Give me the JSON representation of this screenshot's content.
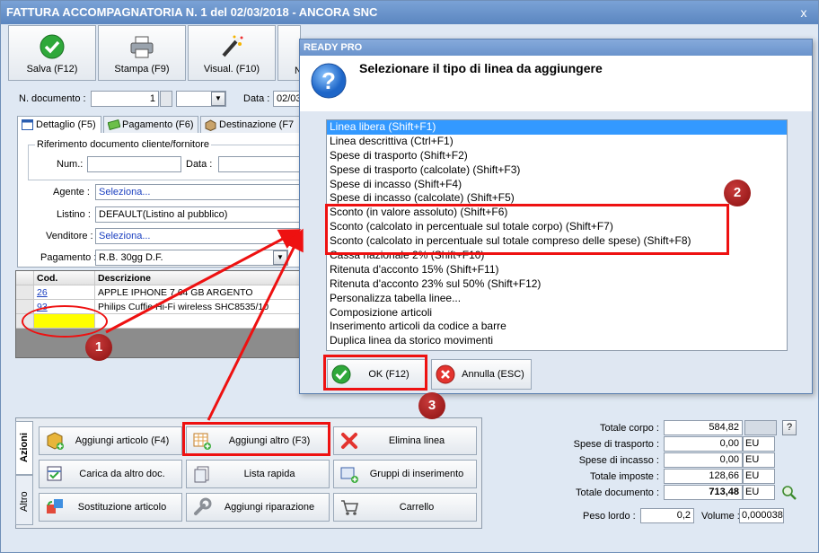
{
  "window": {
    "title": "FATTURA ACCOMPAGNATORIA N. 1 del 02/03/2018 - ANCORA SNC",
    "close": "x"
  },
  "toolbar": {
    "save": "Salva (F12)",
    "print": "Stampa (F9)",
    "visual": "Visual. (F10)",
    "hidden": "N"
  },
  "header": {
    "doc_label": "N. documento :",
    "doc_value": "1",
    "date_label": "Data :",
    "date_value": "02/03"
  },
  "tabs": [
    "Dettaglio (F5)",
    "Pagamento (F6)",
    "Destinazione (F7"
  ],
  "reference": {
    "title": "Riferimento documento cliente/fornitore",
    "num_label": "Num.:",
    "date_label": "Data :"
  },
  "fields": {
    "agente_label": "Agente :",
    "agente_value": "Seleziona...",
    "listino_label": "Listino :",
    "listino_value": "DEFAULT(Listino al pubblico)",
    "venditore_label": "Venditore :",
    "venditore_value": "Seleziona...",
    "pagamento_label": "Pagamento :",
    "pagamento_value": "R.B. 30gg D.F."
  },
  "grid": {
    "col_cod": "Cod.",
    "col_desc": "Descrizione",
    "rows": [
      {
        "cod": "26",
        "desc": "APPLE IPHONE 7 64 GB ARGENTO"
      },
      {
        "cod": "93",
        "desc": "Philips Cuffie Hi-Fi wireless SHC8535/10"
      }
    ]
  },
  "actions": {
    "tab_azioni": "Azioni",
    "tab_altro": "Altro",
    "add_article": "Aggiungi articolo (F4)",
    "add_other": "Aggiungi altro (F3)",
    "delete_line": "Elimina linea",
    "load_other": "Carica da altro doc.",
    "quick_list": "Lista rapida",
    "insert_groups": "Gruppi di inserimento",
    "replace_article": "Sostituzione articolo",
    "add_repair": "Aggiungi riparazione",
    "cart": "Carrello"
  },
  "totals": {
    "corpo_label": "Totale corpo :",
    "corpo_value": "584,82",
    "trasporto_label": "Spese di trasporto :",
    "trasporto_value": "0,00",
    "incasso_label": "Spese di incasso :",
    "incasso_value": "0,00",
    "imposte_label": "Totale imposte :",
    "imposte_value": "128,66",
    "documento_label": "Totale documento :",
    "documento_value": "713,48",
    "currency": "EU",
    "help": "?",
    "peso_label": "Peso lordo :",
    "peso_value": "0,2",
    "volume_label": "Volume :",
    "volume_value": "0,000038"
  },
  "dialog": {
    "title": "READY PRO",
    "heading": "Selezionare il tipo di linea da aggiungere",
    "items": [
      "Linea libera (Shift+F1)",
      "Linea descrittiva (Ctrl+F1)",
      "Spese di trasporto (Shift+F2)",
      "Spese di trasporto (calcolate) (Shift+F3)",
      "Spese di incasso (Shift+F4)",
      "Spese di incasso (calcolate) (Shift+F5)",
      "Sconto (in valore assoluto) (Shift+F6)",
      "Sconto (calcolato in percentuale sul totale corpo) (Shift+F7)",
      "Sconto (calcolato in percentuale sul totale compreso delle spese) (Shift+F8)",
      "Cassa nazionale 2% (Shift+F10)",
      "Ritenuta d'acconto 15% (Shift+F11)",
      "Ritenuta d'acconto 23% sul 50% (Shift+F12)",
      "Personalizza tabella linee...",
      "Composizione articoli",
      "Inserimento articoli da codice a barre",
      "Duplica linea da storico movimenti"
    ],
    "ok": "OK (F12)",
    "cancel": "Annulla (ESC)"
  },
  "annotations": {
    "b1": "1",
    "b2": "2",
    "b3": "3"
  }
}
